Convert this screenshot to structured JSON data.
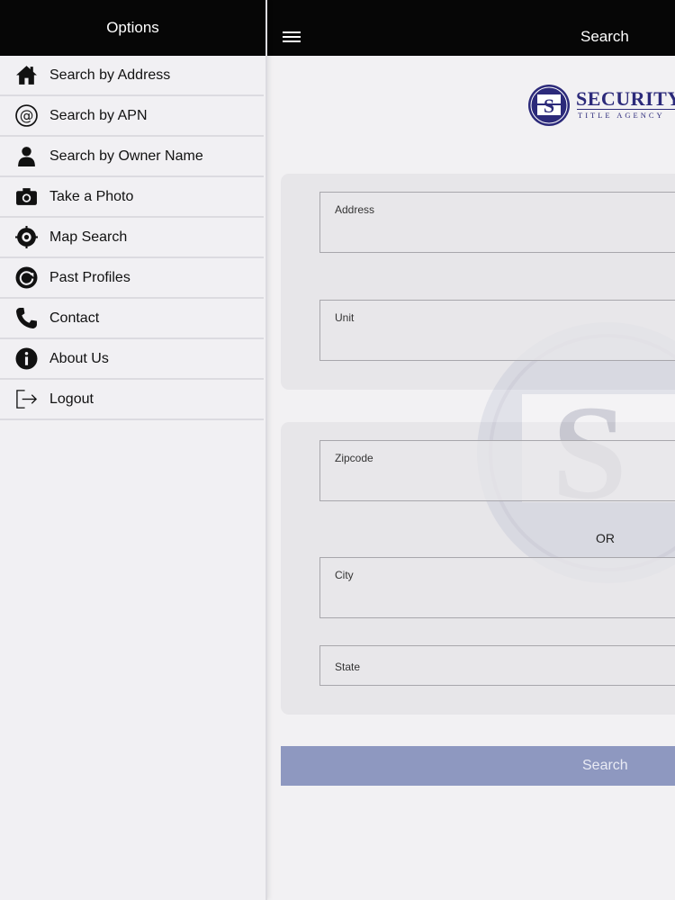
{
  "sidebar": {
    "title": "Options",
    "items": [
      {
        "label": "Search by Address",
        "icon": "home-icon"
      },
      {
        "label": "Search by APN",
        "icon": "at-icon"
      },
      {
        "label": "Search by Owner Name",
        "icon": "person-icon"
      },
      {
        "label": "Take a Photo",
        "icon": "camera-icon"
      },
      {
        "label": "Map Search",
        "icon": "target-icon"
      },
      {
        "label": "Past Profiles",
        "icon": "history-icon"
      },
      {
        "label": "Contact",
        "icon": "phone-icon"
      },
      {
        "label": "About Us",
        "icon": "info-icon"
      },
      {
        "label": "Logout",
        "icon": "logout-icon"
      }
    ]
  },
  "header": {
    "title": "Search",
    "menu_icon": "hamburger-icon"
  },
  "logo": {
    "name": "SECURITY",
    "tagline": "TITLE AGENCY",
    "brand_color": "#2c2a7a"
  },
  "form": {
    "address_label": "Address",
    "unit_label": "Unit",
    "zipcode_label": "Zipcode",
    "or_text": "OR",
    "city_label": "City",
    "state_label": "State",
    "search_label": "Search"
  },
  "colors": {
    "topbar": "#060606",
    "button": "#8e98c0",
    "card": "#e7e6e9"
  }
}
